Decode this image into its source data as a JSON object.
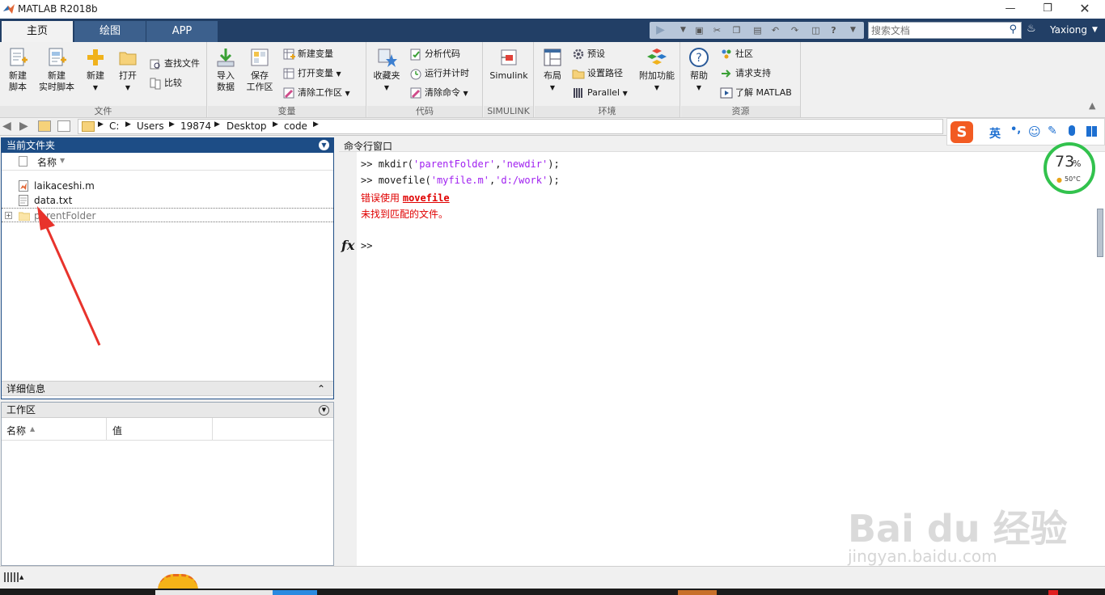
{
  "window": {
    "title": "MATLAB R2018b",
    "user": "Yaxiong"
  },
  "tabs": [
    {
      "label": "主页"
    },
    {
      "label": "绘图"
    },
    {
      "label": "APP"
    }
  ],
  "search": {
    "placeholder": "搜索文档"
  },
  "ribbon": {
    "file": {
      "label": "文件",
      "new_script": [
        "新建",
        "脚本"
      ],
      "new_live_script": [
        "新建",
        "实时脚本"
      ],
      "new": "新建",
      "open": "打开",
      "find_files": "查找文件",
      "compare": "比较"
    },
    "variable": {
      "label": "变量",
      "import": [
        "导入",
        "数据"
      ],
      "save_ws": [
        "保存",
        "工作区"
      ],
      "new_var": "新建变量",
      "open_var": "打开变量",
      "clear_ws": "清除工作区"
    },
    "code": {
      "label": "代码",
      "favorites": "收藏夹",
      "analyze": "分析代码",
      "run_time": "运行并计时",
      "clear_cmd": "清除命令"
    },
    "simulink": {
      "label": "SIMULINK",
      "simulink": "Simulink"
    },
    "env": {
      "label": "环境",
      "layout": "布局",
      "prefs": "预设",
      "set_path": "设置路径",
      "parallel": "Parallel",
      "addons": "附加功能"
    },
    "res": {
      "label": "资源",
      "help": "帮助",
      "community": "社区",
      "support": "请求支持",
      "learn": "了解 MATLAB"
    }
  },
  "path": {
    "crumbs": [
      "C:",
      "Users",
      "19874",
      "Desktop",
      "code"
    ]
  },
  "current_folder": {
    "title": "当前文件夹",
    "col_name": "名称",
    "files": [
      {
        "name": "laikaceshi.m",
        "type": "mfile"
      },
      {
        "name": "data.txt",
        "type": "txt"
      },
      {
        "name": "parentFolder",
        "type": "folder"
      }
    ],
    "details": "详细信息"
  },
  "workspace": {
    "title": "工作区",
    "col_name": "名称",
    "col_value": "值"
  },
  "command_window": {
    "title": "命令行窗口",
    "prompt": ">>",
    "line1": {
      "cmd": "mkdir(",
      "a1": "'parentFolder'",
      "sep": ",",
      "a2": "'newdir'",
      "end": ");"
    },
    "line2": {
      "cmd": "movefile(",
      "a1": "'myfile.m'",
      "sep": ",",
      "a2": "'d:/work'",
      "end": ");"
    },
    "error1_prefix": "错误使用",
    "error1_func": "movefile",
    "error2": "未找到匹配的文件。",
    "fx": "fx"
  },
  "ime": {
    "lang": "英",
    "punct": "•,"
  },
  "monitor": {
    "percent": "73",
    "unit": "%",
    "temp": "50°C"
  },
  "watermark": {
    "brand": "Bai du 经验",
    "url": "jingyan.baidu.com"
  }
}
